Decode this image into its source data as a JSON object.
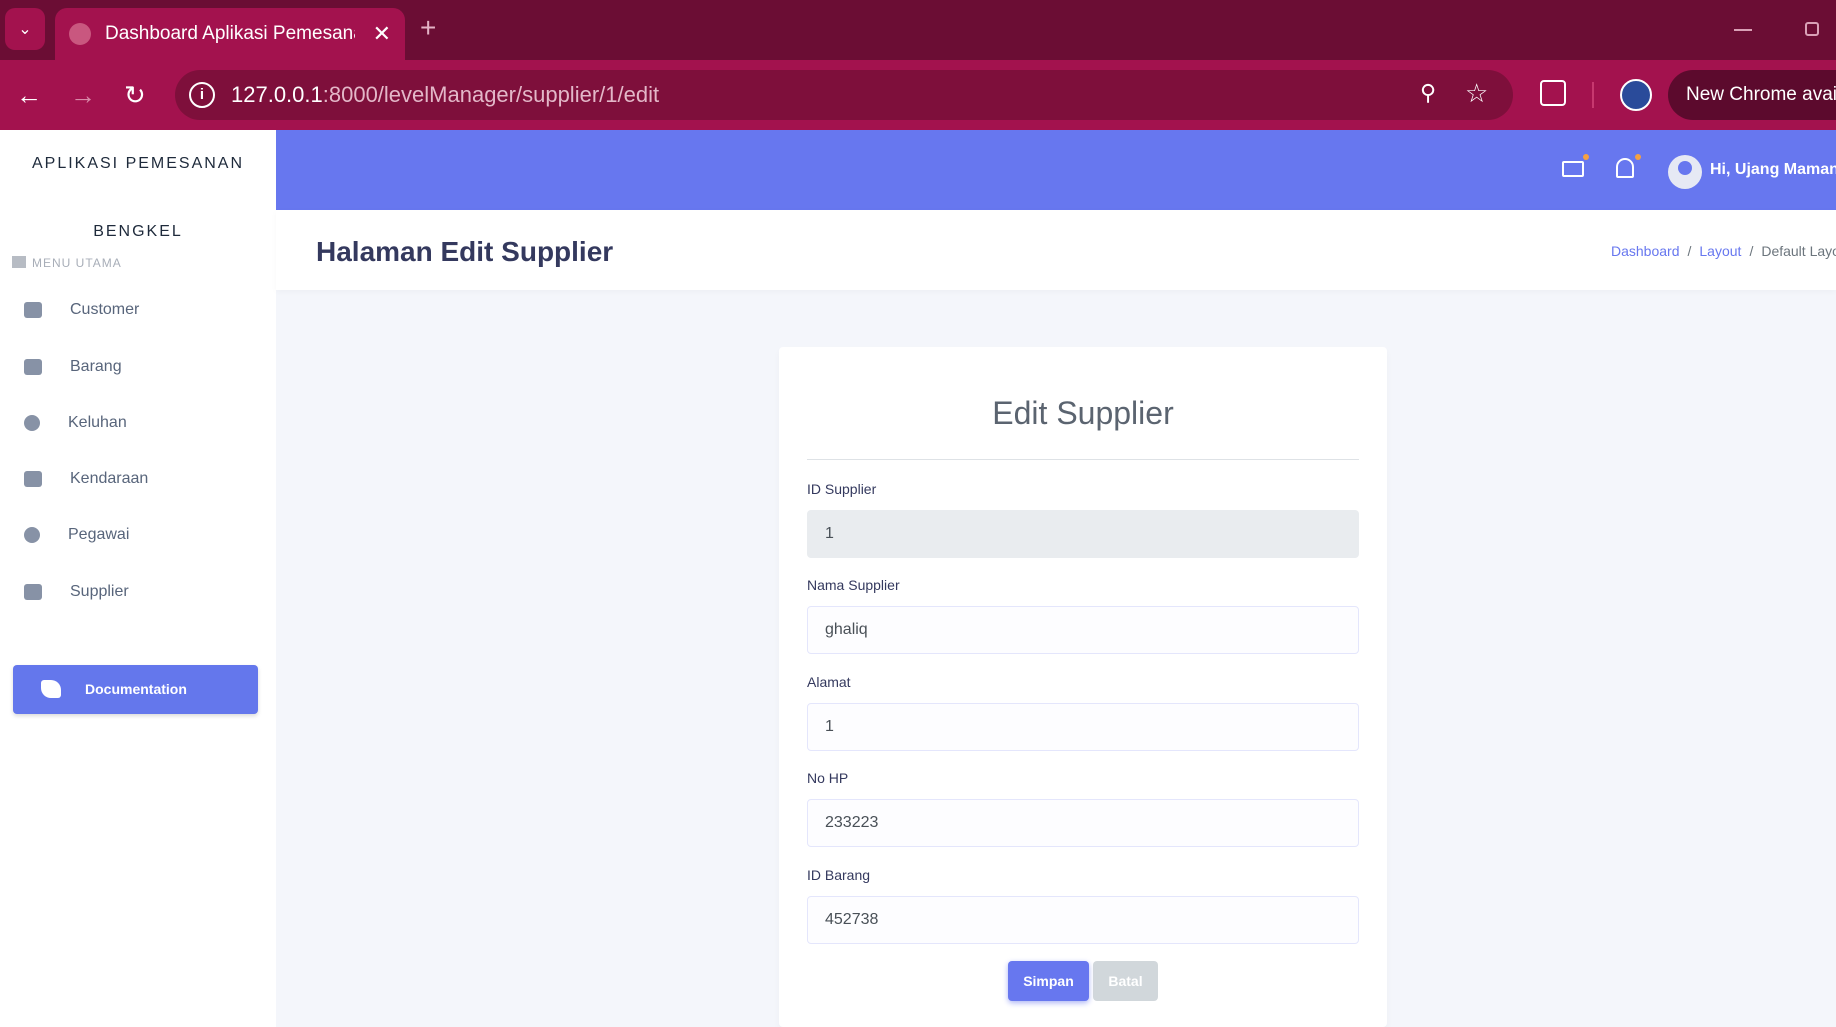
{
  "browser": {
    "tab_title": "Dashboard Aplikasi Pemesanan",
    "url_host": "127.0.0.1",
    "url_rest": ":8000/levelManager/supplier/1/edit",
    "new_chrome": "New Chrome availa"
  },
  "sidebar": {
    "brand_line1": "APLIKASI PEMESANAN",
    "brand_line2": "BENGKEL",
    "menu_header": "MENU UTAMA",
    "items": [
      {
        "label": "Customer",
        "icon": "users-icon"
      },
      {
        "label": "Barang",
        "icon": "box-icon"
      },
      {
        "label": "Keluhan",
        "icon": "exclamation-circle-icon"
      },
      {
        "label": "Kendaraan",
        "icon": "car-icon"
      },
      {
        "label": "Pegawai",
        "icon": "user-tie-icon"
      },
      {
        "label": "Supplier",
        "icon": "truck-icon"
      }
    ],
    "documentation": "Documentation"
  },
  "topbar": {
    "greeting": "Hi, Ujang Maman"
  },
  "header": {
    "title": "Halaman Edit Supplier",
    "breadcrumb": [
      "Dashboard",
      "Layout",
      "Default Layo"
    ]
  },
  "form": {
    "title": "Edit Supplier",
    "fields": [
      {
        "label": "ID Supplier",
        "value": "1"
      },
      {
        "label": "Nama Supplier",
        "value": "ghaliq"
      },
      {
        "label": "Alamat",
        "value": "1"
      },
      {
        "label": "No HP",
        "value": "233223"
      },
      {
        "label": "ID Barang",
        "value": "452738"
      }
    ],
    "save_label": "Simpan",
    "cancel_label": "Batal"
  },
  "colors": {
    "browser_frame": "#a3124e",
    "primary": "#6777ef"
  }
}
